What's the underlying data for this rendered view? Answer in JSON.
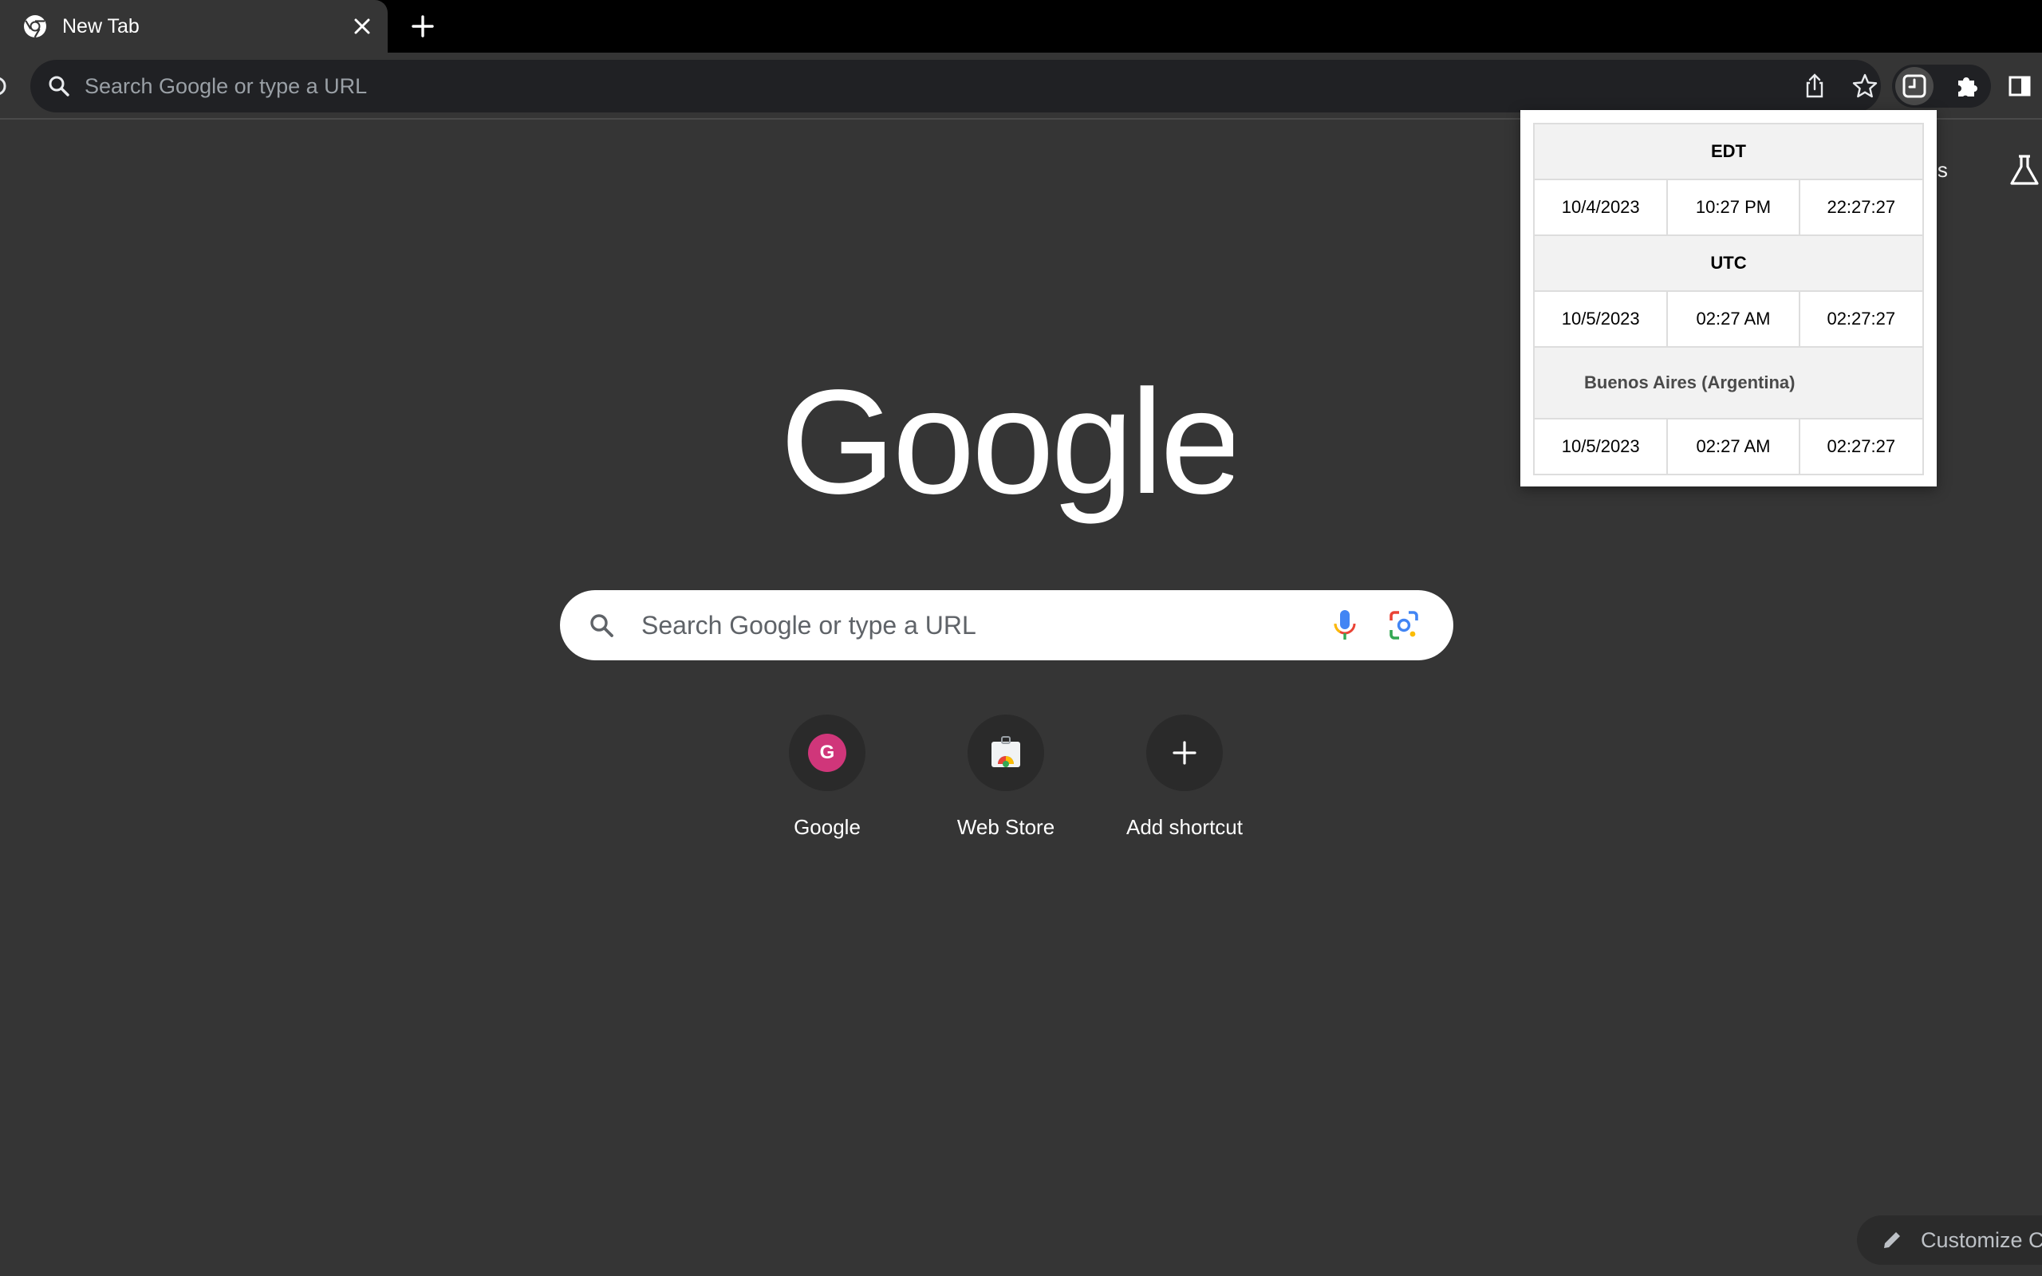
{
  "browser": {
    "tab": {
      "title": "New Tab",
      "favicon": "chrome-icon",
      "close": "close-icon"
    },
    "new_tab": "plus-icon",
    "omnibox": {
      "placeholder": "Search Google or type a URL"
    },
    "icons": [
      "share-icon",
      "star-icon",
      "clock-extension-icon",
      "puzzle-icon",
      "side-panel-icon"
    ]
  },
  "ntp": {
    "images_link": "ges",
    "logo_text": "Google",
    "search": {
      "placeholder": "Search Google or type a URL"
    },
    "shortcuts": [
      {
        "label": "Google",
        "avatar_letter": "G",
        "icon": "avatar-icon"
      },
      {
        "label": "Web Store",
        "icon": "web-store-icon"
      },
      {
        "label": "Add shortcut",
        "icon": "plus-icon"
      }
    ],
    "customize_label": "Customize C"
  },
  "popup": {
    "zones": [
      {
        "name": "EDT",
        "date": "10/4/2023",
        "time12": "10:27 PM",
        "time24": "22:27:27"
      },
      {
        "name": "UTC",
        "date": "10/5/2023",
        "time12": "02:27 AM",
        "time24": "02:27:27"
      },
      {
        "name": "Buenos Aires (Argentina)",
        "date": "10/5/2023",
        "time12": "02:27 AM",
        "time24": "02:27:27"
      }
    ]
  },
  "colors": {
    "page_bg": "#353535",
    "tabstrip_bg": "#000000",
    "omnibox_bg": "#202124",
    "avatar_pink": "#d0367a"
  }
}
